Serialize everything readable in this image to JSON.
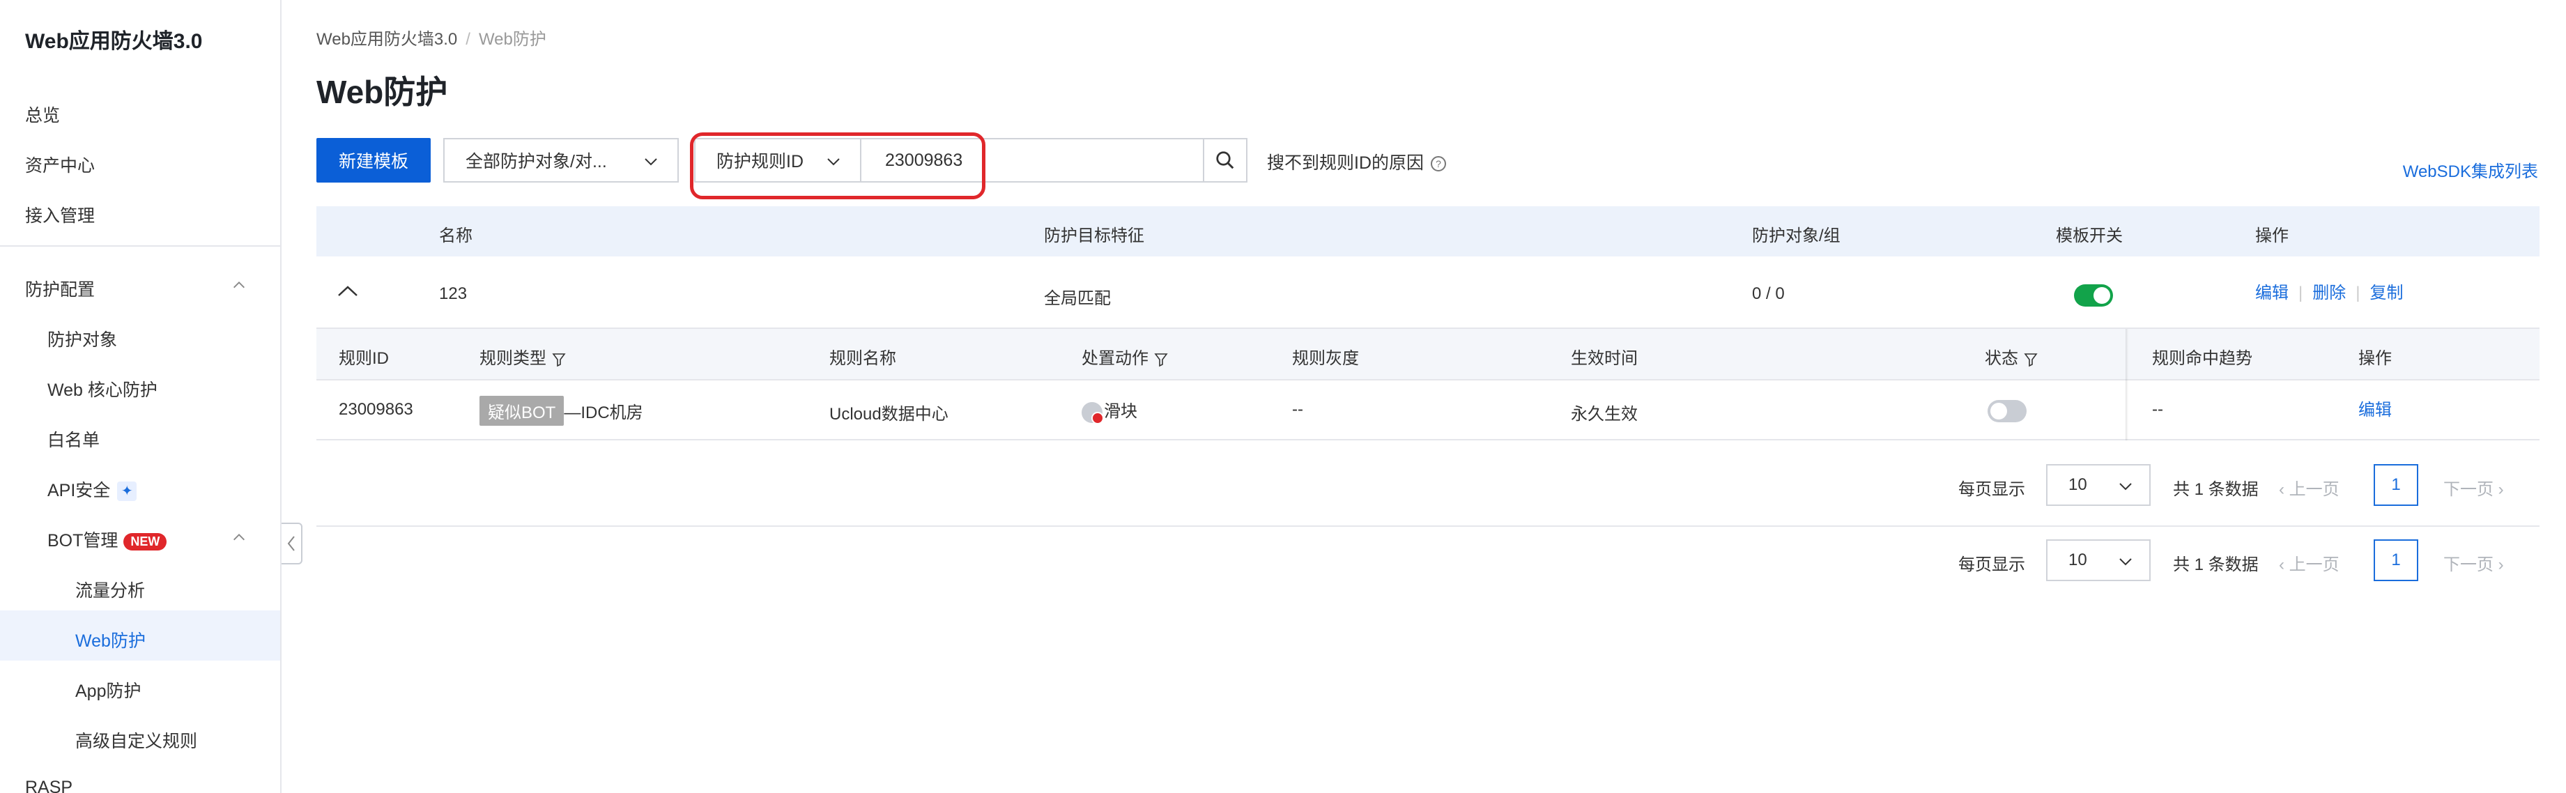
{
  "sidebar": {
    "title": "Web应用防火墙3.0",
    "items": [
      {
        "label": "总览"
      },
      {
        "label": "资产中心"
      },
      {
        "label": "接入管理"
      }
    ],
    "section": {
      "label": "防护配置"
    },
    "sub_items": [
      {
        "label": "防护对象"
      },
      {
        "label": "Web 核心防护"
      },
      {
        "label": "白名单"
      },
      {
        "label": "API安全"
      },
      {
        "label": "BOT管理",
        "badge": "NEW"
      }
    ],
    "bot_items": [
      {
        "label": "流量分析"
      },
      {
        "label": "Web防护"
      },
      {
        "label": "App防护"
      },
      {
        "label": "高级自定义规则"
      }
    ],
    "last_item": {
      "label": "RASP"
    }
  },
  "breadcrumb": {
    "root": "Web应用防火墙3.0",
    "sep": "/",
    "current": "Web防护"
  },
  "page_title": "Web防护",
  "toolbar": {
    "new_template": "新建模板",
    "object_filter": "全部防护对象/对...",
    "search_type": "防护规则ID",
    "search_value": "23009863",
    "hint": "搜不到规则ID的原因",
    "hint_icon": "?",
    "sdk_link": "WebSDK集成列表"
  },
  "table": {
    "headers": {
      "name": "名称",
      "feature": "防护目标特征",
      "objects": "防护对象/组",
      "switch": "模板开关",
      "ops": "操作"
    },
    "row": {
      "name": "123",
      "feature": "全局匹配",
      "objects": "0 / 0",
      "switch_on": true,
      "edit": "编辑",
      "delete": "删除",
      "copy": "复制",
      "sep": "|"
    },
    "inner_headers": {
      "rule_id": "规则ID",
      "rule_type": "规则类型",
      "rule_name": "规则名称",
      "action": "处置动作",
      "gray": "规则灰度",
      "time": "生效时间",
      "status": "状态",
      "trend": "规则命中趋势",
      "ops": "操作"
    },
    "inner_row": {
      "rule_id": "23009863",
      "rule_type_tag": "疑似BOT",
      "rule_type_rest": "—IDC机房",
      "rule_name": "Ucloud数据中心",
      "action": "滑块",
      "gray": "--",
      "time": "永久生效",
      "status_on": false,
      "trend": "--",
      "edit": "编辑"
    }
  },
  "pagination": {
    "per_page_label": "每页显示",
    "per_page": "10",
    "total": "共 1 条数据",
    "prev": "上一页",
    "next": "下一页",
    "page": "1"
  }
}
